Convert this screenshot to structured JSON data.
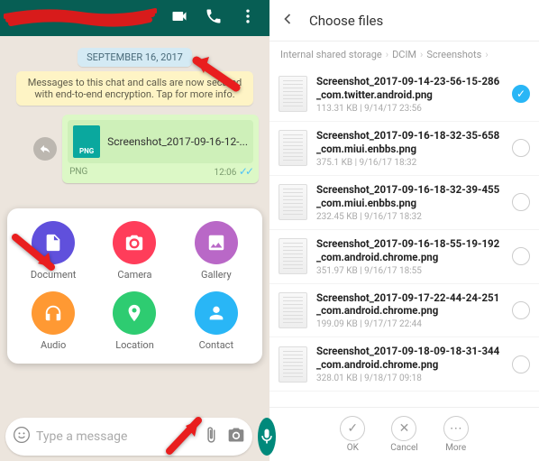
{
  "whatsapp": {
    "date_chip": "SEPTEMBER 16, 2017",
    "encryption_notice": "Messages to this chat and calls are now secured with end-to-end encryption. Tap for more info.",
    "message": {
      "filetype": "PNG",
      "filename": "Screenshot_2017-09-16-12-...",
      "meta_label": "PNG",
      "time": "12:06"
    },
    "attach": {
      "document": "Document",
      "camera": "Camera",
      "gallery": "Gallery",
      "audio": "Audio",
      "location": "Location",
      "contact": "Contact"
    },
    "input_placeholder": "Type a message"
  },
  "picker": {
    "title": "Choose files",
    "breadcrumb": [
      "Internal shared storage",
      "DCIM",
      "Screenshots"
    ],
    "files": [
      {
        "name": "Screenshot_2017-09-14-23-56-15-286_com.twitter.android.png",
        "size": "113.31 KB",
        "date": "9/14/17 23:56",
        "selected": true
      },
      {
        "name": "Screenshot_2017-09-16-18-32-35-658_com.miui.enbbs.png",
        "size": "375.1 KB",
        "date": "9/16/17 18:32",
        "selected": false
      },
      {
        "name": "Screenshot_2017-09-16-18-32-39-455_com.miui.enbbs.png",
        "size": "232.45 KB",
        "date": "9/16/17 18:32",
        "selected": false
      },
      {
        "name": "Screenshot_2017-09-16-18-55-19-192_com.android.chrome.png",
        "size": "351.97 KB",
        "date": "9/16/17 18:55",
        "selected": false
      },
      {
        "name": "Screenshot_2017-09-17-22-44-24-251_com.android.chrome.png",
        "size": "199.09 KB",
        "date": "9/17/17 22:44",
        "selected": false
      },
      {
        "name": "Screenshot_2017-09-18-09-18-31-344_com.android.chrome.png",
        "size": "328.01 KB",
        "date": "9/18/17 09:18",
        "selected": false
      }
    ],
    "actions": {
      "ok": "OK",
      "cancel": "Cancel",
      "more": "More"
    }
  }
}
